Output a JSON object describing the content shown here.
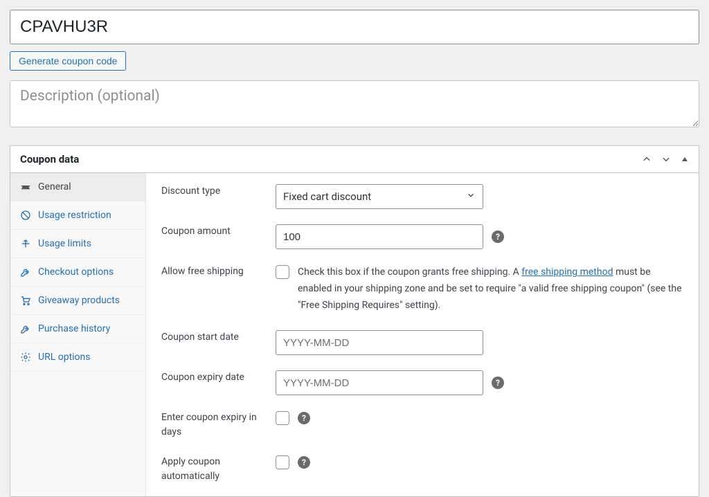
{
  "coupon_code": "CPAVHU3R",
  "generate_btn": "Generate coupon code",
  "description_placeholder": "Description (optional)",
  "panel_title": "Coupon data",
  "tabs": {
    "general": "General",
    "usage_restriction": "Usage restriction",
    "usage_limits": "Usage limits",
    "checkout": "Checkout options",
    "giveaway": "Giveaway products",
    "purchase": "Purchase history",
    "url": "URL options"
  },
  "fields": {
    "discount_type_label": "Discount type",
    "discount_type_value": "Fixed cart discount",
    "coupon_amount_label": "Coupon amount",
    "coupon_amount_value": "100",
    "free_ship_label": "Allow free shipping",
    "free_ship_text_1": "Check this box if the coupon grants free shipping. A ",
    "free_ship_link": "free shipping method",
    "free_ship_text_2": " must be enabled in your shipping zone and be set to require \"a valid free shipping coupon\" (see the \"Free Shipping Requires\" setting).",
    "start_label": "Coupon start date",
    "start_placeholder": "YYYY-MM-DD",
    "expiry_label": "Coupon expiry date",
    "expiry_placeholder": "YYYY-MM-DD",
    "expiry_days_label": "Enter coupon expiry in days",
    "auto_label": "Apply coupon automatically"
  }
}
